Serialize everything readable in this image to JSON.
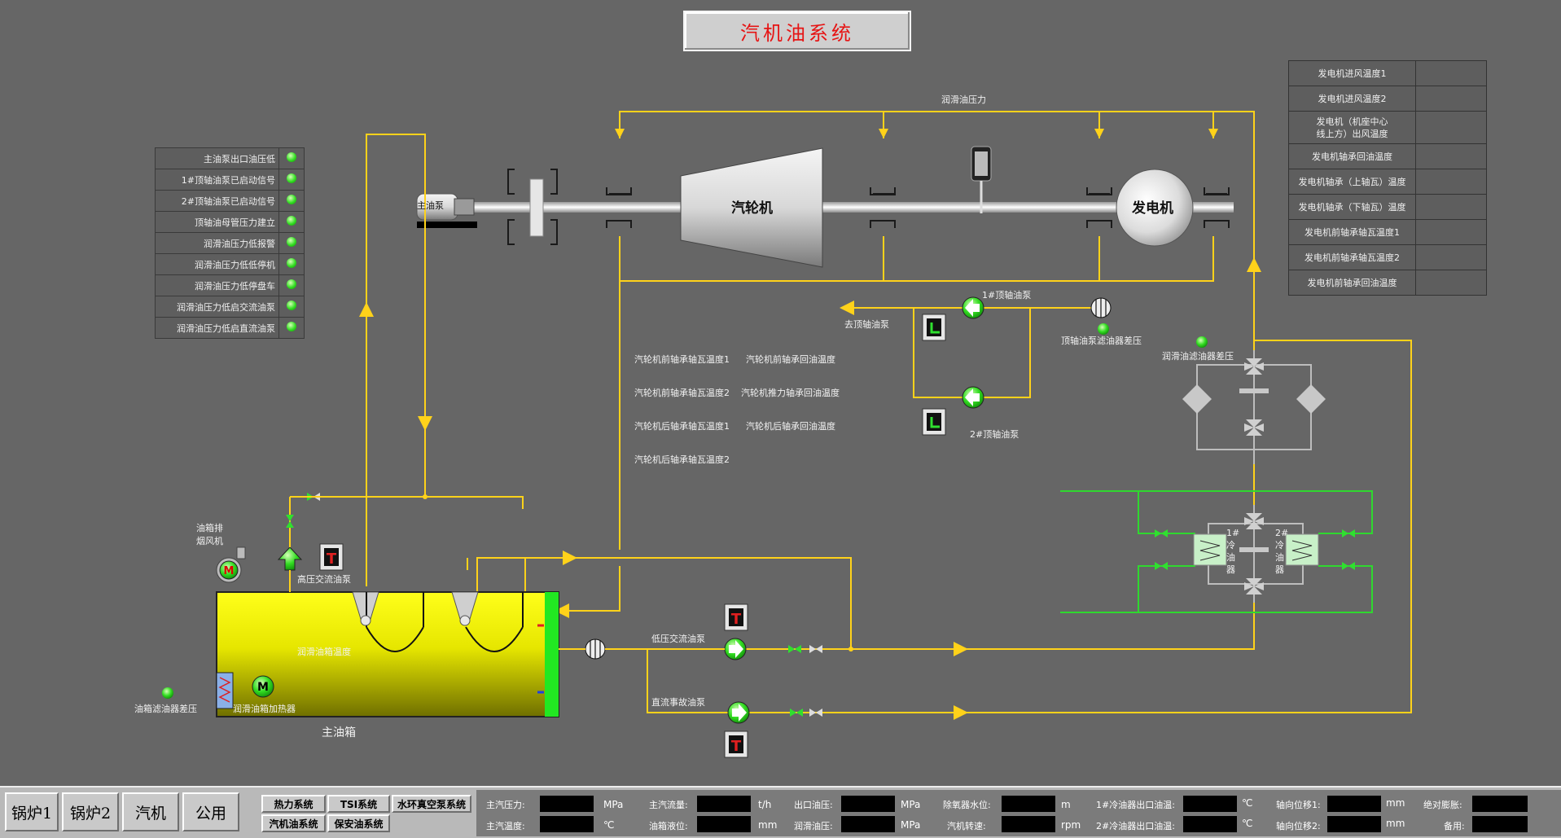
{
  "title": "汽机油系统",
  "alarms": [
    {
      "label": "主油泵出口油压低"
    },
    {
      "label": "1#顶轴油泵已启动信号"
    },
    {
      "label": "2#顶轴油泵已启动信号"
    },
    {
      "label": "顶轴油母管压力建立"
    },
    {
      "label": "润滑油压力低报警"
    },
    {
      "label": "润滑油压力低低停机"
    },
    {
      "label": "润滑油压力低停盘车"
    },
    {
      "label": "润滑油压力低启交流油泵"
    },
    {
      "label": "润滑油压力低启直流油泵"
    }
  ],
  "gen_temps": [
    {
      "label": "发电机进风温度1",
      "value": ""
    },
    {
      "label": "发电机进风温度2",
      "value": ""
    },
    {
      "label": "发电机（机座中心",
      "label2": "线上方）出风温度",
      "value": ""
    },
    {
      "label": "发电机轴承回油温度",
      "value": ""
    },
    {
      "label": "发电机轴承（上轴瓦）温度",
      "value": ""
    },
    {
      "label": "发电机轴承（下轴瓦）温度",
      "value": ""
    },
    {
      "label": "发电机前轴承轴瓦温度1",
      "value": ""
    },
    {
      "label": "发电机前轴承轴瓦温度2",
      "value": ""
    },
    {
      "label": "发电机前轴承回油温度",
      "value": ""
    }
  ],
  "diagram": {
    "lube_pressure": "润滑油压力",
    "main_oil_pump": "主油泵",
    "turbine": "汽轮机",
    "generator": "发电机",
    "jack_pump_1": "1#顶轴油泵",
    "jack_pump_2": "2#顶轴油泵",
    "to_jack_pump": "去顶轴油泵",
    "jack_filter_dp": "顶轴油泵滤油器差压",
    "lube_filter_dp": "润滑油滤油器差压",
    "t1a": "汽轮机前轴承轴瓦温度1",
    "t1b": "汽轮机前轴承回油温度",
    "t2a": "汽轮机前轴承轴瓦温度2",
    "t2b": "汽轮机推力轴承回油温度",
    "t3a": "汽轮机后轴承轴瓦温度1",
    "t3b": "汽轮机后轴承回油温度",
    "t4a": "汽轮机后轴承轴瓦温度2",
    "exhaust_fan_1": "油箱排",
    "exhaust_fan_2": "烟风机",
    "hp_ac_pump": "高压交流油泵",
    "tank_temp": "润滑油箱温度",
    "tank_heater": "润滑油箱加热器",
    "tank_filter_dp": "油箱滤油器差压",
    "main_tank": "主油箱",
    "lp_ac_pump": "低压交流油泵",
    "dc_pump": "直流事故油泵",
    "cooler1": [
      "1#",
      "冷",
      "油",
      "器"
    ],
    "cooler2": [
      "2#",
      "冷",
      "油",
      "器"
    ]
  },
  "nav": {
    "boiler1": "锅炉1",
    "boiler2": "锅炉2",
    "turbine": "汽机",
    "common": "公用",
    "thermal": "热力系统",
    "tsi": "TSI系统",
    "vacuum": "水环真空泵系统",
    "oil": "汽机油系统",
    "safety_oil": "保安油系统"
  },
  "status": [
    {
      "label": "主汽压力:",
      "unit": "MPa"
    },
    {
      "label": "主汽温度:",
      "unit": "℃"
    },
    {
      "label": "主汽流量:",
      "unit": "t/h"
    },
    {
      "label": "油箱液位:",
      "unit": "mm"
    },
    {
      "label": "出口油压:",
      "unit": "MPa"
    },
    {
      "label": "润滑油压:",
      "unit": "MPa"
    },
    {
      "label": "除氧器水位:",
      "unit": "m"
    },
    {
      "label": "汽机转速:",
      "unit": "rpm"
    },
    {
      "label": "1#冷油器出口油温:",
      "unit": "℃"
    },
    {
      "label": "2#冷油器出口油温:",
      "unit": "℃"
    },
    {
      "label": "轴向位移1:",
      "unit": "mm"
    },
    {
      "label": "轴向位移2:",
      "unit": "mm"
    },
    {
      "label": "绝对膨胀:",
      "unit": ""
    },
    {
      "label": "备用:",
      "unit": ""
    }
  ],
  "colors": {
    "background": "#666666",
    "oil_line": "#ffd21a",
    "water_line": "#2fd82f",
    "led": "#33dd22",
    "title_text": "#e61414"
  }
}
